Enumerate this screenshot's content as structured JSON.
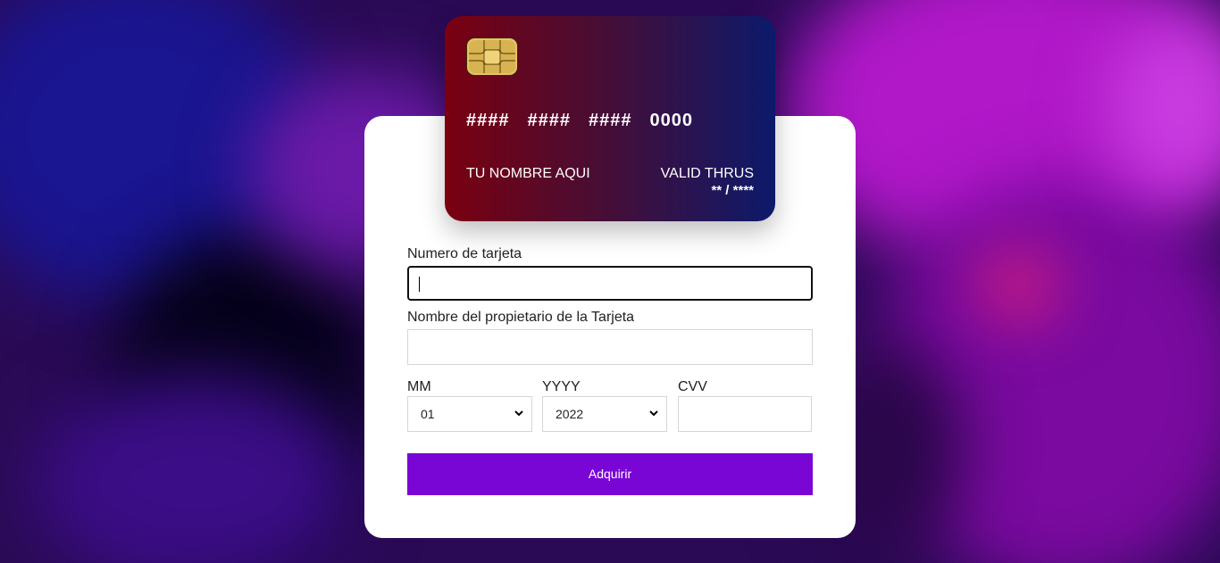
{
  "card": {
    "number_groups": [
      "####",
      "####",
      "####",
      "0000"
    ],
    "holder": "TU NOMBRE AQUI",
    "valid_label": "VALID THRUS",
    "valid_value": "** / ****",
    "chip_icon": "chip-icon",
    "gradient_colors": [
      "#7a0010",
      "#4a0d33",
      "#0c1a6b"
    ]
  },
  "form": {
    "card_number": {
      "label": "Numero de tarjeta",
      "value": ""
    },
    "holder_name": {
      "label": "Nombre del propietario de la Tarjeta",
      "value": ""
    },
    "month": {
      "label": "MM",
      "selected": "01"
    },
    "year": {
      "label": "YYYY",
      "selected": "2022"
    },
    "cvv": {
      "label": "CVV",
      "value": ""
    },
    "submit_label": "Adquirir"
  },
  "colors": {
    "accent": "#7a06d6",
    "panel": "#ffffff"
  }
}
